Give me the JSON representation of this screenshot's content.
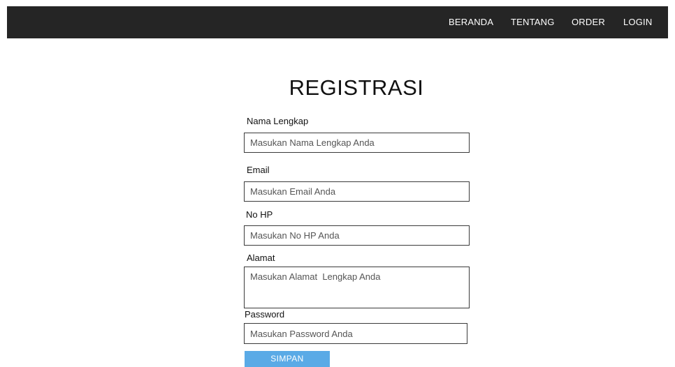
{
  "nav": {
    "items": [
      {
        "label": "BERANDA"
      },
      {
        "label": "TENTANG"
      },
      {
        "label": "ORDER"
      },
      {
        "label": "LOGIN"
      }
    ]
  },
  "form": {
    "title": "REGISTRASI",
    "fields": {
      "nama": {
        "label": "Nama Lengkap",
        "placeholder": "Masukan Nama Lengkap Anda"
      },
      "email": {
        "label": "Email",
        "placeholder": "Masukan Email Anda"
      },
      "nohp": {
        "label": "No HP",
        "placeholder": "Masukan No HP Anda"
      },
      "alamat": {
        "label": "Alamat",
        "placeholder": "Masukan Alamat  Lengkap Anda"
      },
      "password": {
        "label": "Password",
        "placeholder": "Masukan Password Anda"
      }
    },
    "submit_label": "SIMPAN"
  },
  "colors": {
    "navbar_bg": "#252525",
    "button_bg": "#5aaae6",
    "text": "#111111"
  }
}
